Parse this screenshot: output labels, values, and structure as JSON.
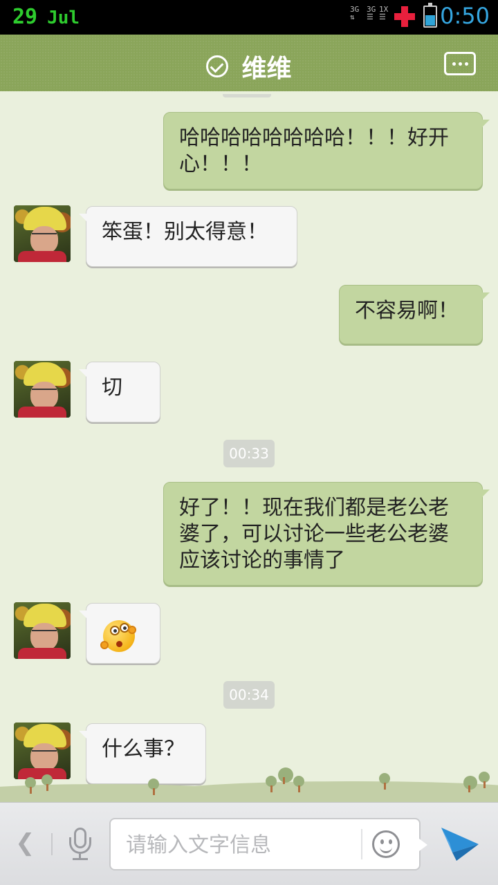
{
  "status_bar": {
    "day": "29",
    "month": "Jul",
    "net1": "3G",
    "net2": "3G",
    "net3": "1X",
    "time": "0:50",
    "battery_color": "#2fa4d8",
    "time_color": "#35a6e0"
  },
  "header": {
    "title": "维维",
    "check_icon": "check-circle-icon",
    "menu_icon": "chat-more-icon",
    "bg_color": "#8aa55a"
  },
  "messages": [
    {
      "side": "me",
      "text": "哈哈哈哈哈哈哈哈！！！好开心！！！"
    },
    {
      "side": "them",
      "text": "笨蛋！别太得意！"
    },
    {
      "side": "me",
      "text": "不容易啊！"
    },
    {
      "side": "them",
      "text": "切"
    },
    {
      "side": "time",
      "text": "00:33"
    },
    {
      "side": "me",
      "text": "好了！！现在我们都是老公老婆了，可以讨论一些老公老婆应该讨论的事情了"
    },
    {
      "side": "them",
      "emoji": "surprised-emoji-icon"
    },
    {
      "side": "time",
      "text": "00:34"
    },
    {
      "side": "them",
      "text": "什么事？"
    }
  ],
  "input_bar": {
    "placeholder": "请输入文字信息",
    "back_icon": "chevron-left-icon",
    "mic_icon": "microphone-icon",
    "emoji_icon": "smiley-icon",
    "send_icon": "paper-plane-send-icon",
    "send_color": "#2d8fd6"
  }
}
